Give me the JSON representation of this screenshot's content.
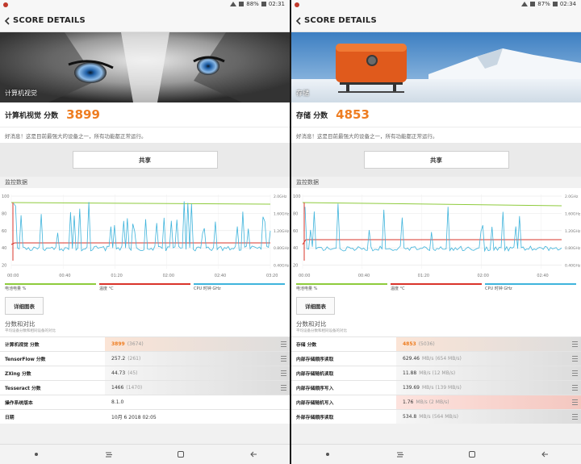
{
  "colors": {
    "accent": "#ee7d21",
    "battery": "#8ecb3c",
    "temperature": "#d9342b",
    "cpu": "#3fb4dc"
  },
  "left": {
    "status": {
      "battery": "88%",
      "time": "02:31"
    },
    "title": "SCORE DETAILS",
    "hero_label": "计算机视觉",
    "score_label": "计算机视觉 分数",
    "score": "3899",
    "message": "好消息！这是目前最强大的设备之一，所有功能都正常运行。",
    "share": "共享",
    "monitor_title": "监控数据",
    "y_ticks": [
      "100",
      "80",
      "60",
      "40",
      "20"
    ],
    "y2_ticks": [
      "2.0GHz",
      "1.60GHz",
      "1.20GHz",
      "0.80GHz",
      "0.40GHz"
    ],
    "x_ticks": [
      "00:00",
      "00:40",
      "01:20",
      "02:00",
      "02:40",
      "03:20"
    ],
    "legend": [
      "电池电量 %",
      "温度 °C",
      "CPU 时钟 GHz"
    ],
    "detail_button": "详细图表",
    "compare_title": "分数和对比",
    "compare_sub": "平均设备分数和相同设备的对比",
    "rows": [
      {
        "name": "计算机视觉 分数",
        "value": "3899",
        "ref": "(3674)"
      },
      {
        "name": "TensorFlow 分数",
        "value": "257.2",
        "ref": "(261)"
      },
      {
        "name": "ZXing 分数",
        "value": "44.73",
        "ref": "(45)"
      },
      {
        "name": "Tesseract 分数",
        "value": "1466",
        "ref": "(1470)"
      },
      {
        "name": "操作系统版本",
        "value": "8.1.0",
        "ref": ""
      },
      {
        "name": "日期",
        "value": "10月 6 2018 02:05",
        "ref": ""
      }
    ]
  },
  "right": {
    "status": {
      "battery": "87%",
      "time": "02:34"
    },
    "title": "SCORE DETAILS",
    "hero_label": "存储",
    "score_label": "存储 分数",
    "score": "4853",
    "message": "好消息！这是目前最强大的设备之一，所有功能都正常运行。",
    "share": "共享",
    "monitor_title": "监控数据",
    "y_ticks": [
      "100",
      "80",
      "60",
      "40",
      "20"
    ],
    "y2_ticks": [
      "2.0GHz",
      "1.60GHz",
      "1.20GHz",
      "0.80GHz",
      "0.40GHz"
    ],
    "x_ticks": [
      "00:00",
      "00:40",
      "01:20",
      "02:00",
      "02:40"
    ],
    "legend": [
      "电池电量 %",
      "温度 °C",
      "CPU 时钟 GHz"
    ],
    "detail_button": "详细图表",
    "compare_title": "分数和对比",
    "compare_sub": "平均设备分数和相同设备的对比",
    "rows": [
      {
        "name": "存储 分数",
        "value": "4853",
        "ref": "(5036)"
      },
      {
        "name": "内部存储顺序读取",
        "value": "629.46",
        "ref": "MB/s (654 MB/s)"
      },
      {
        "name": "内部存储随机读取",
        "value": "11.88",
        "ref": "MB/s (12 MB/s)"
      },
      {
        "name": "内部存储顺序写入",
        "value": "139.69",
        "ref": "MB/s (139 MB/s)"
      },
      {
        "name": "内部存储随机写入",
        "value": "1.76",
        "ref": "MB/s (2 MB/s)"
      },
      {
        "name": "外部存储顺序读取",
        "value": "534.8",
        "ref": "MB/s (564 MB/s)"
      }
    ]
  }
}
